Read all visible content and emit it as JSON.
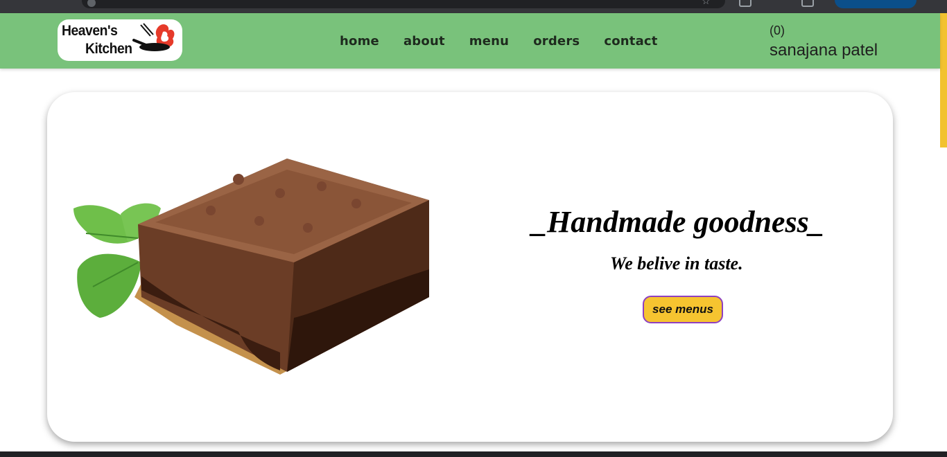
{
  "brand": {
    "line1": "Heaven's",
    "line2": "Kitchen"
  },
  "nav": {
    "items": [
      {
        "label": "home"
      },
      {
        "label": "about"
      },
      {
        "label": "menu"
      },
      {
        "label": "orders"
      },
      {
        "label": "contact"
      }
    ]
  },
  "account": {
    "cart_count": "(0)",
    "user_name": "sanajana patel"
  },
  "hero": {
    "headline": "_Handmade goodness_",
    "tagline": "We belive in taste.",
    "cta_label": "see menus"
  },
  "colors": {
    "navbar": "#79c27b",
    "cta_fill": "#f6c430",
    "cta_border": "#8e3fc0"
  }
}
